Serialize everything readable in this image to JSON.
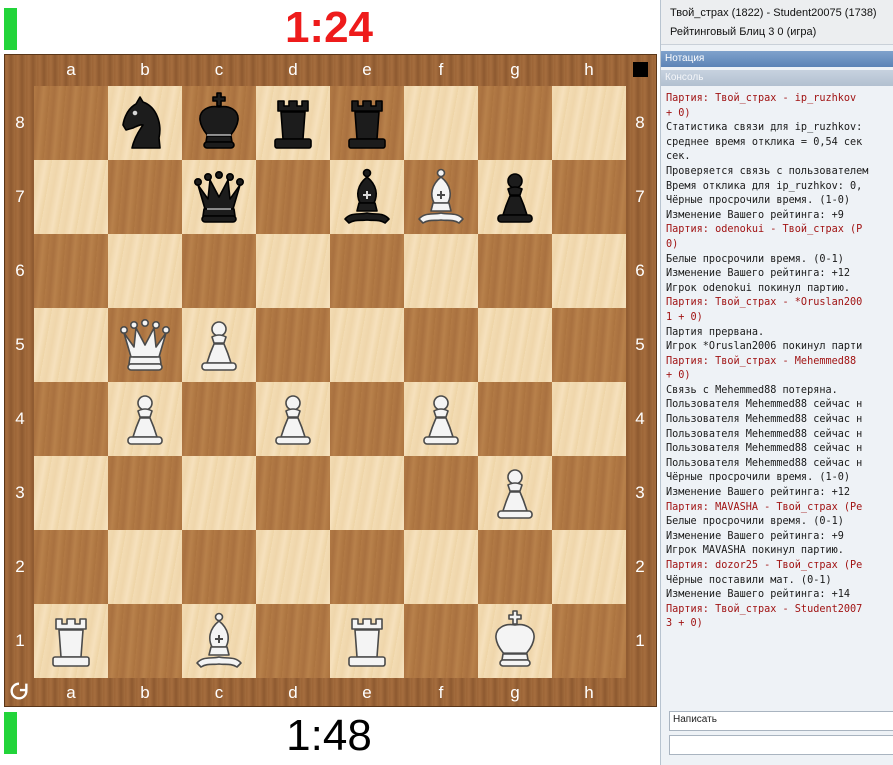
{
  "clocks": {
    "top": "1:24",
    "top_color": "#ee1b1b",
    "bottom": "1:48",
    "bottom_color": "#111111",
    "indicator_color": "#22d43a"
  },
  "board": {
    "files": [
      "a",
      "b",
      "c",
      "d",
      "e",
      "f",
      "g",
      "h"
    ],
    "ranks": [
      "8",
      "7",
      "6",
      "5",
      "4",
      "3",
      "2",
      "1"
    ],
    "light_color": "#f0d9b0",
    "dark_color": "#b07845",
    "frame_color": "#9c6537",
    "pieces": [
      {
        "square": "b8",
        "piece": "knight",
        "color": "black"
      },
      {
        "square": "c8",
        "piece": "king",
        "color": "black"
      },
      {
        "square": "d8",
        "piece": "rook",
        "color": "black"
      },
      {
        "square": "e8",
        "piece": "rook",
        "color": "black"
      },
      {
        "square": "c7",
        "piece": "queen",
        "color": "black"
      },
      {
        "square": "e7",
        "piece": "bishop",
        "color": "black"
      },
      {
        "square": "f7",
        "piece": "bishop",
        "color": "white"
      },
      {
        "square": "g7",
        "piece": "pawn",
        "color": "black"
      },
      {
        "square": "b5",
        "piece": "queen",
        "color": "white"
      },
      {
        "square": "c5",
        "piece": "pawn",
        "color": "white"
      },
      {
        "square": "b4",
        "piece": "pawn",
        "color": "white"
      },
      {
        "square": "d4",
        "piece": "pawn",
        "color": "white"
      },
      {
        "square": "f4",
        "piece": "pawn",
        "color": "white"
      },
      {
        "square": "g3",
        "piece": "pawn",
        "color": "white"
      },
      {
        "square": "a1",
        "piece": "rook",
        "color": "white"
      },
      {
        "square": "c1",
        "piece": "bishop",
        "color": "white"
      },
      {
        "square": "e1",
        "piece": "rook",
        "color": "white"
      },
      {
        "square": "g1",
        "piece": "king",
        "color": "white"
      }
    ],
    "turn_indicator_icon": "black-square-icon",
    "flip_icon": "rotate-icon"
  },
  "header": {
    "players": "Твой_страх (1822) - Student20075 (1738)",
    "game_type": "Рейтинговый Блиц 3 0  (игра)"
  },
  "tabs": {
    "notation": "Нотация",
    "console": "Консоль"
  },
  "console_lines": [
    {
      "text": "Партия: Твой_страх - ip_ruzhkov",
      "type": "game"
    },
    {
      "text": "+ 0)",
      "type": "game"
    },
    {
      "text": "Статистика связи для ip_ruzhkov:",
      "type": "info"
    },
    {
      "text": "среднее время отклика = 0,54 сек",
      "type": "info"
    },
    {
      "text": "сек.",
      "type": "info"
    },
    {
      "text": "Проверяется связь с пользователем",
      "type": "info"
    },
    {
      "text": "Время отклика для ip_ruzhkov: 0,",
      "type": "info"
    },
    {
      "text": "Чёрные просрочили время. (1-0)",
      "type": "info"
    },
    {
      "text": "Изменение Вашего рейтинга: +9",
      "type": "info"
    },
    {
      "text": "Партия: odenokui - Твой_страх (Р",
      "type": "game"
    },
    {
      "text": "0)",
      "type": "game"
    },
    {
      "text": "Белые просрочили время. (0-1)",
      "type": "info"
    },
    {
      "text": "Изменение Вашего рейтинга: +12",
      "type": "info"
    },
    {
      "text": "Игрок odenokui покинул партию.",
      "type": "info"
    },
    {
      "text": "Партия: Твой_страх - *Oruslan200",
      "type": "game"
    },
    {
      "text": "1 + 0)",
      "type": "game"
    },
    {
      "text": "Партия прервана.",
      "type": "info"
    },
    {
      "text": "Игрок *Oruslan2006 покинул парти",
      "type": "info"
    },
    {
      "text": "Партия: Твой_страх - Mehemmed88",
      "type": "game"
    },
    {
      "text": "+ 0)",
      "type": "game"
    },
    {
      "text": "Связь с Mehemmed88 потеряна.",
      "type": "info"
    },
    {
      "text": "Пользователя Mehemmed88 сейчас н",
      "type": "info"
    },
    {
      "text": "Пользователя Mehemmed88 сейчас н",
      "type": "info"
    },
    {
      "text": "Пользователя Mehemmed88 сейчас н",
      "type": "info"
    },
    {
      "text": "Пользователя Mehemmed88 сейчас н",
      "type": "info"
    },
    {
      "text": "Пользователя Mehemmed88 сейчас н",
      "type": "info"
    },
    {
      "text": "Чёрные просрочили время. (1-0)",
      "type": "info"
    },
    {
      "text": "Изменение Вашего рейтинга: +12",
      "type": "info"
    },
    {
      "text": "Партия: MAVASHA - Твой_страх (Ре",
      "type": "game"
    },
    {
      "text": "Белые просрочили время. (0-1)",
      "type": "info"
    },
    {
      "text": "Изменение Вашего рейтинга: +9",
      "type": "info"
    },
    {
      "text": "Игрок MAVASHA покинул партию.",
      "type": "info"
    },
    {
      "text": "Партия: dozor25 - Твой_страх (Ре",
      "type": "game"
    },
    {
      "text": "Чёрные поставили мат. (0-1)",
      "type": "info"
    },
    {
      "text": "Изменение Вашего рейтинга: +14",
      "type": "info"
    },
    {
      "text": "Партия: Твой_страх - Student2007",
      "type": "game"
    },
    {
      "text": "3 + 0)",
      "type": "game"
    }
  ],
  "chat": {
    "send_label": "Написать",
    "input_value": ""
  }
}
